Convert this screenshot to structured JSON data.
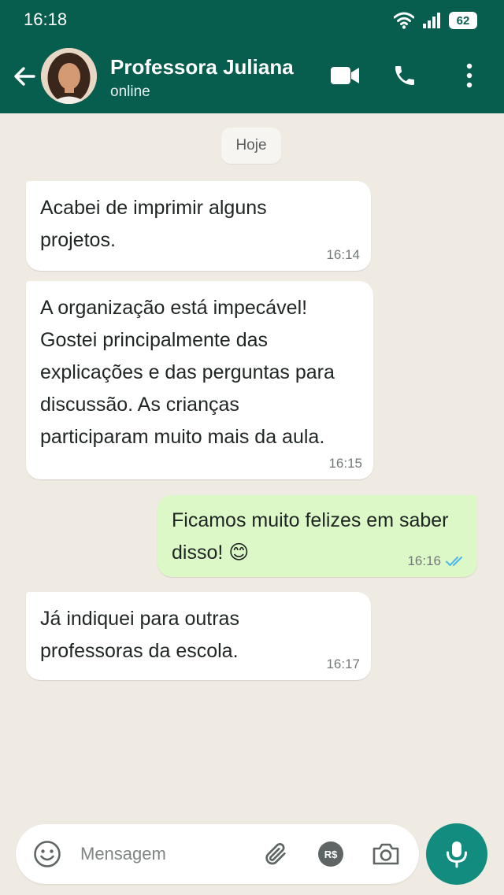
{
  "status_bar": {
    "time": "16:18",
    "battery": "62"
  },
  "header": {
    "contact_name": "Professora Juliana",
    "contact_status": "online"
  },
  "chat": {
    "day_label": "Hoje",
    "messages": [
      {
        "direction": "incoming",
        "lines": [
          "Acabei de imprimir alguns",
          "projetos."
        ],
        "time": "16:14"
      },
      {
        "direction": "incoming",
        "lines": [
          "A organização está impecável!",
          "Gostei principalmente das",
          "explicações e das perguntas para",
          "discussão. As crianças",
          "participaram muito mais da aula."
        ],
        "time": "16:15"
      },
      {
        "direction": "outgoing",
        "lines": [
          "Ficamos muito felizes em saber",
          "disso! 😊"
        ],
        "time": "16:16",
        "read_status": "read"
      },
      {
        "direction": "incoming",
        "lines": [
          "Já indiquei para outras",
          "professoras da escola."
        ],
        "time": "16:17"
      }
    ]
  },
  "composer": {
    "placeholder": "Mensagem",
    "payment_label": "R$"
  },
  "colors": {
    "header": "#075e4f",
    "background": "#efeae2",
    "outgoing_bubble": "#dcf8c6",
    "mic_button": "#128c7e",
    "read_ticks": "#4fb6ec"
  }
}
